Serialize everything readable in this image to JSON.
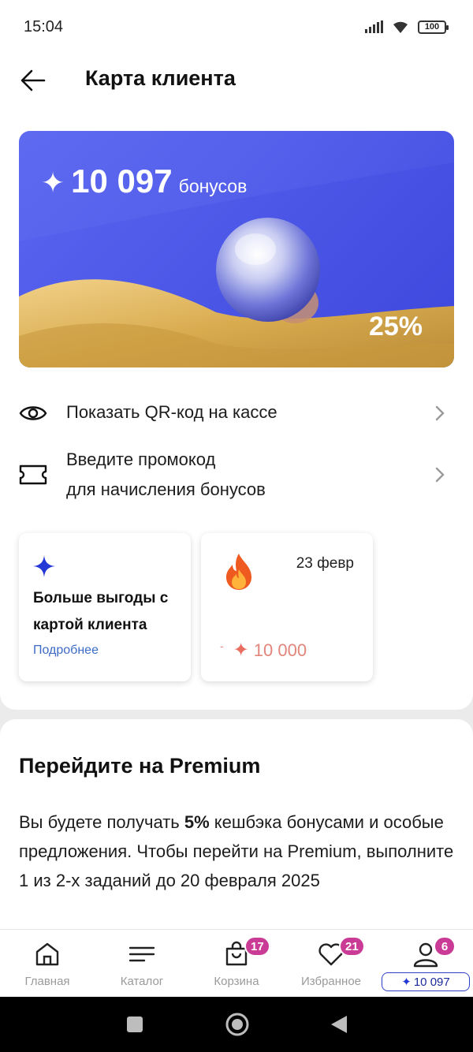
{
  "status_bar": {
    "time": "15:04",
    "battery": "100"
  },
  "header": {
    "title": "Карта клиента"
  },
  "card": {
    "star": "✦",
    "bonus_amount": "10 097",
    "bonus_unit": "бонусов",
    "percent": "25%"
  },
  "actions": [
    {
      "label": "Показать QR-код на кассе"
    },
    {
      "label_line1": "Введите промокод",
      "label_line2": "для начисления бонусов"
    }
  ],
  "tiles": {
    "benefits": {
      "title": "Больше выгоды с картой клиента",
      "link": "Подробнее"
    },
    "expiring": {
      "date": "23 февр",
      "minus": "-",
      "star": "✦",
      "amount": "10 000"
    }
  },
  "premium": {
    "title": "Перейдите на Premium",
    "text_before": "Вы будете получать ",
    "text_bold": "5%",
    "text_after": " кешбэка бонусами и особые предложения. Чтобы перейти на Premium, выполните 1 из 2-х заданий до 20 февраля 2025"
  },
  "bottom_nav": {
    "home": {
      "label": "Главная"
    },
    "catalog": {
      "label": "Каталог"
    },
    "cart": {
      "label": "Корзина",
      "badge": "17"
    },
    "favorites": {
      "label": "Избранное",
      "badge": "21"
    },
    "profile": {
      "badge": "6",
      "star": "✦",
      "bonus": "10 097"
    }
  },
  "colors": {
    "accent": "#4a55e6",
    "badge": "#c93b95",
    "link": "#3d6bc7",
    "expire": "#e2857a"
  }
}
